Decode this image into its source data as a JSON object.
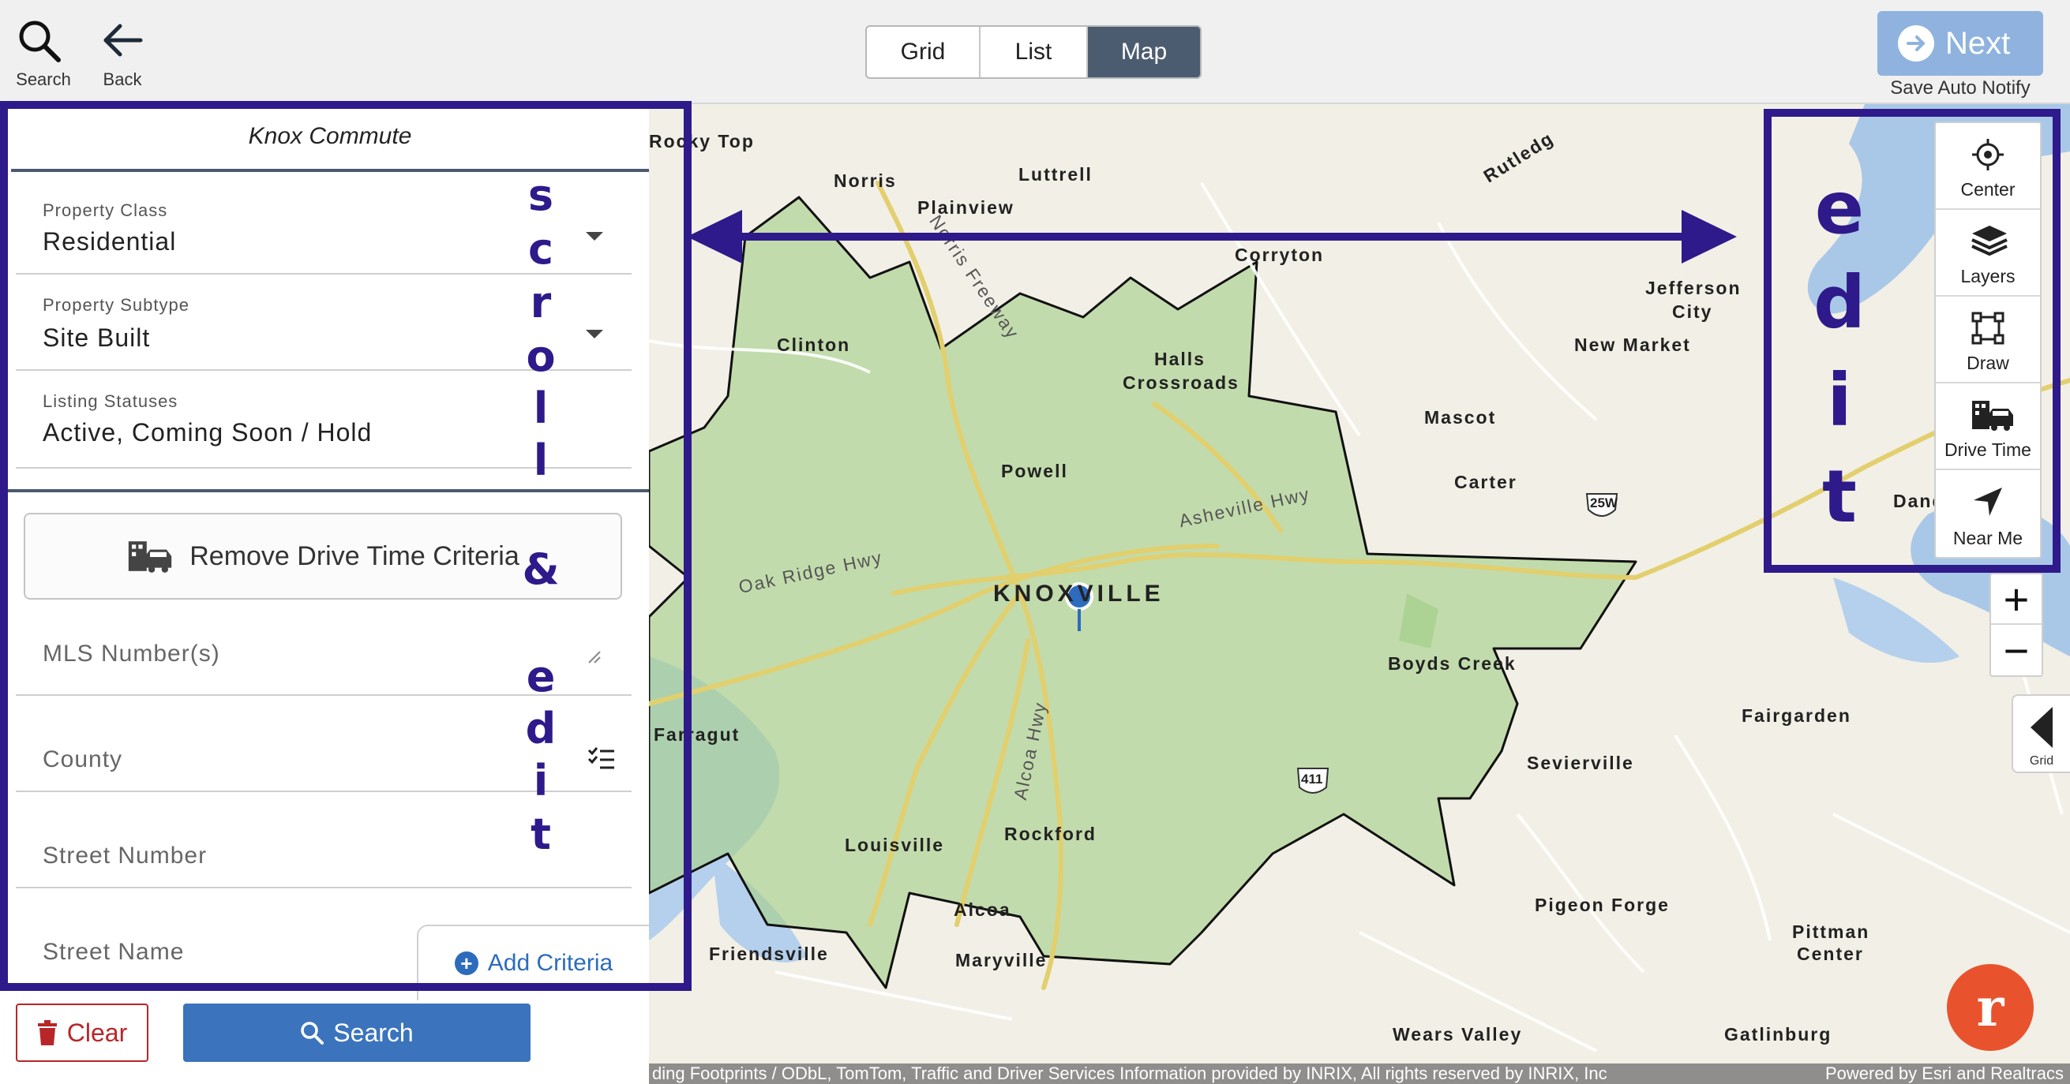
{
  "toolbar": {
    "search_label": "Search",
    "back_label": "Back",
    "view_tabs": [
      "Grid",
      "List",
      "Map"
    ],
    "active_tab": "Map",
    "next_label": "Next",
    "save_auto_notify": "Save Auto Notify"
  },
  "panel": {
    "title": "Knox Commute",
    "property_class": {
      "caption": "Property Class",
      "value": "Residential"
    },
    "property_subtype": {
      "caption": "Property Subtype",
      "value": "Site Built"
    },
    "listing_statuses": {
      "caption": "Listing Statuses",
      "value": "Active, Coming Soon / Hold"
    },
    "remove_drive_time": "Remove Drive Time Criteria",
    "mls_number": "MLS Number(s)",
    "county": "County",
    "street_number": "Street Number",
    "street_name": "Street Name",
    "add_criteria": "Add Criteria"
  },
  "actions": {
    "clear": "Clear",
    "search": "Search"
  },
  "map": {
    "towns": {
      "rocky_top": "Rocky Top",
      "norris": "Norris",
      "luttrell": "Luttrell",
      "plainview": "Plainview",
      "corryton": "Corryton",
      "rutledge": "Rutledg",
      "jefferson_city_1": "Jefferson",
      "jefferson_city_2": "City",
      "new_market": "New Market",
      "clinton": "Clinton",
      "halls_1": "Halls",
      "halls_2": "Crossroads",
      "mascot": "Mascot",
      "powell": "Powell",
      "carter": "Carter",
      "dandridge": "Dandridge",
      "knoxville": "KNOXVILLE",
      "boyds_creek": "Boyds Creek",
      "fairgarden": "Fairgarden",
      "farragut": "Farragut",
      "sevierville": "Sevierville",
      "louisville": "Louisville",
      "rockford": "Rockford",
      "alcoa": "Alcoa",
      "pigeon_forge": "Pigeon Forge",
      "friendsville": "Friendsville",
      "maryville": "Maryville",
      "pittman_1": "Pittman",
      "pittman_2": "Center",
      "wears_valley": "Wears Valley",
      "gatlinburg": "Gatlinburg"
    },
    "roads": {
      "norris_freeway": "Norris Freeway",
      "oak_ridge_hwy": "Oak Ridge Hwy",
      "asheville_hwy": "Asheville Hwy",
      "alcoa_hwy": "Alcoa Hwy",
      "shield_25w": "25W",
      "shield_411": "411"
    },
    "attribution": "ding Footprints / ODbL, TomTom, Traffic and Driver Services Information provided by INRIX, All rights reserved by INRIX, Inc",
    "powered_by": "Powered by Esri and Realtracs",
    "tools": [
      "Center",
      "Layers",
      "Draw",
      "Drive Time",
      "Near Me"
    ],
    "zoom_in": "+",
    "zoom_out": "−",
    "grid_tab": "Grid",
    "logo_letter": "r"
  },
  "annotations": {
    "scroll_letters": [
      "s",
      "c",
      "r",
      "o",
      "l",
      "l"
    ],
    "ampersand": "&",
    "edit_letters_left": [
      "e",
      "d",
      "i",
      "t"
    ],
    "edit_letters_right": [
      "e",
      "d",
      "i",
      "t"
    ]
  },
  "colors": {
    "annotation": "#2e1a8a",
    "drive_time_area": "#a8cf8e",
    "search_button": "#3b74bd",
    "clear_button": "#b8262a",
    "next_button": "#8fb3de",
    "logo": "#e8532e"
  }
}
